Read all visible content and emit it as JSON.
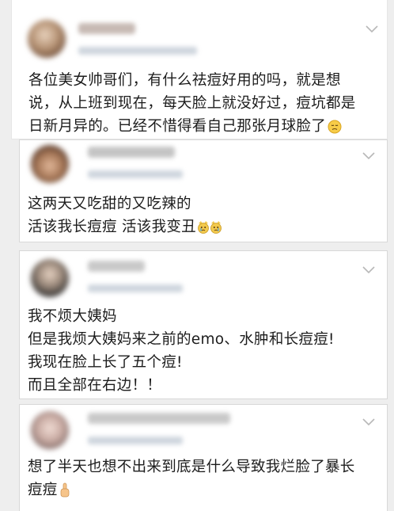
{
  "comments": [
    {
      "text_lines": [
        "各位美女帅哥们，有什么祛痘好用的吗，就是想",
        "说，从上班到现在，每天脸上就没好过，痘坑都是",
        "日新月异的。已经不惜得看自己那张月球脸了"
      ],
      "trailing_emoji": "pensive-face-emoji"
    },
    {
      "text_lines": [
        "这两天又吃甜的又吃辣的",
        "活该我长痘痘 活该我变丑"
      ],
      "trailing_emoji": "crying-cat-emoji"
    },
    {
      "text_lines": [
        "我不烦大姨妈",
        "但是我烦大姨妈来之前的emo、水肿和长痘痘!",
        "我现在脸上长了五个痘!",
        "而且全部在右边！！"
      ]
    },
    {
      "text_lines": [
        "想了半天也想不出来到底是什么导致我烂脸了暴长",
        "痘痘"
      ],
      "trailing_emoji": "raised-finger-emoji"
    }
  ],
  "icons": {
    "expand": "chevron-down-icon"
  },
  "colors": {
    "background": "#eeeeee",
    "card": "#ffffff",
    "border": "#d8d8d8",
    "text": "#1c1c1c",
    "chevron": "#b8b8b8"
  }
}
